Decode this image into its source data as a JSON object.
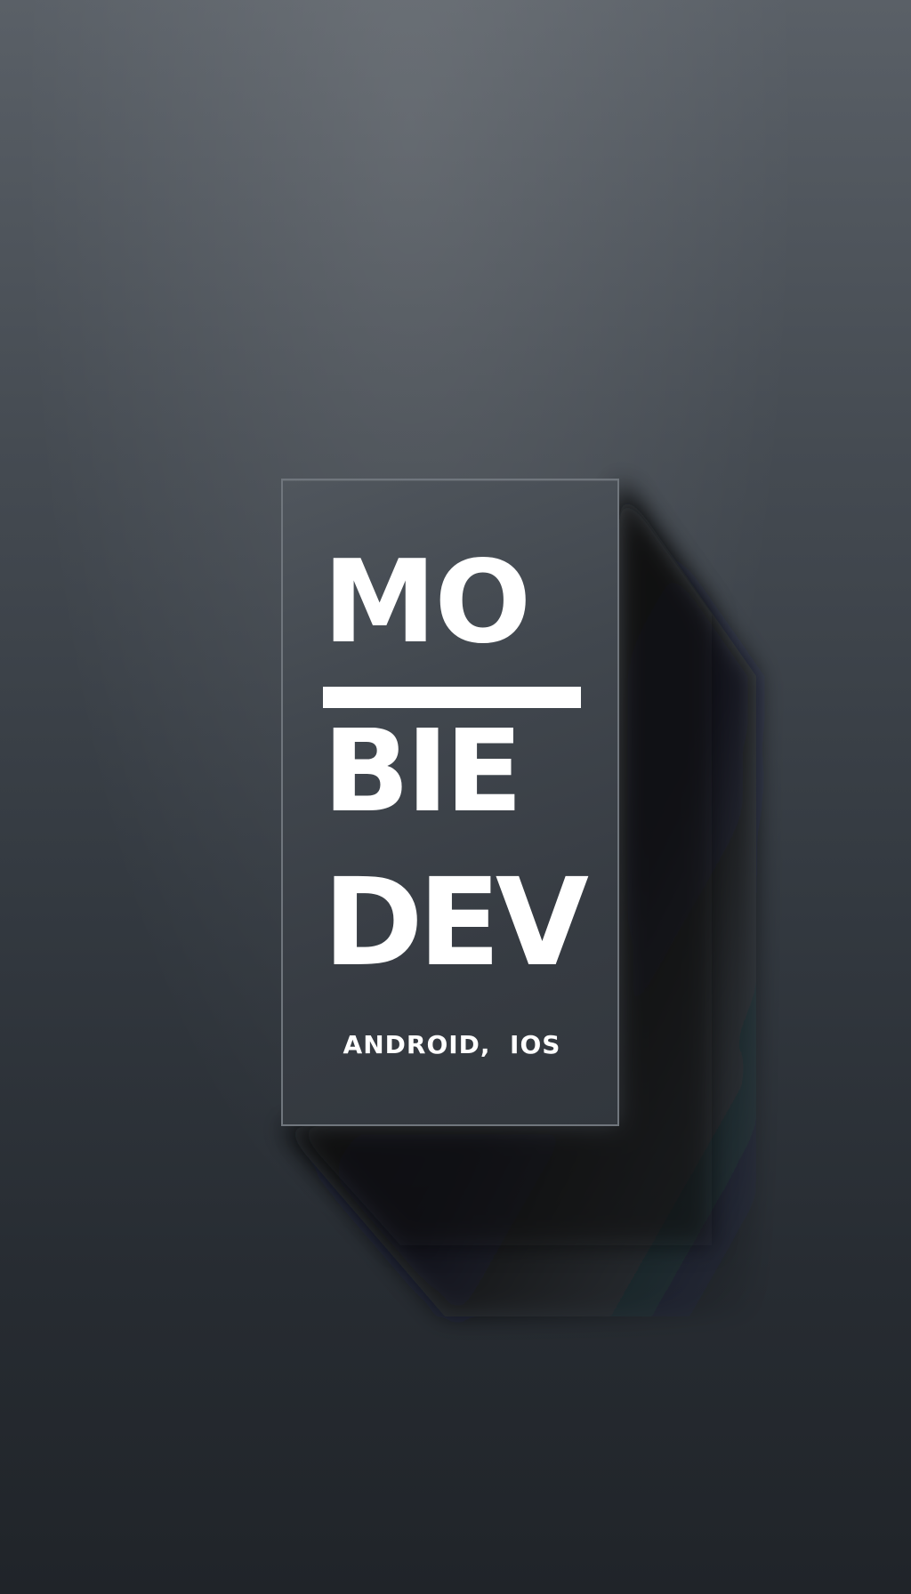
{
  "logo": {
    "line1": "MO",
    "line2": "BIE",
    "line3": "DEV",
    "subtitle": "ANDROID,  IOS"
  },
  "colors": {
    "background_top": "#5a6067",
    "background_bottom": "#202429",
    "card": "#41474e",
    "card_border": "#70767d",
    "text": "#ffffff",
    "shadow": "#0b1015"
  }
}
